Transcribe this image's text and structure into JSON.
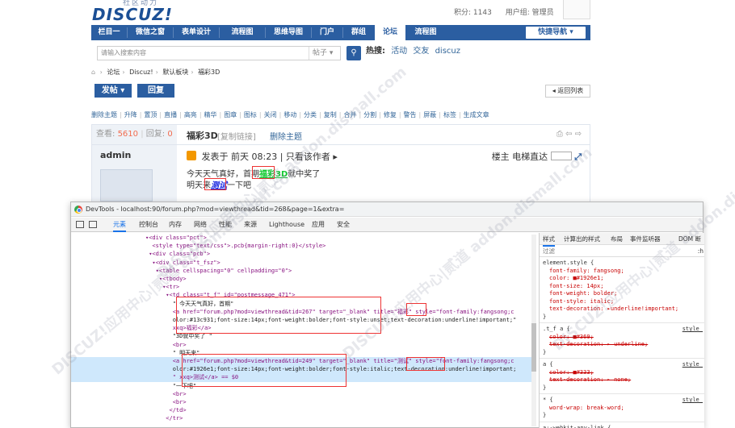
{
  "forum": {
    "logo_small": "社区动力",
    "logo_big": "DISCUZ!",
    "userbar": [
      "积分: 1143",
      "用户组: 管理员"
    ],
    "nav": [
      "栏目一",
      "微信之窗",
      "表单设计",
      "流程图",
      "思维导图",
      "门户",
      "群组",
      "论坛",
      "流程图"
    ],
    "nav_active": "论坛",
    "quick_nav": "快捷导航 ▾",
    "search_placeholder": "请输入搜索内容",
    "search_type": "帖子 ▾",
    "hot_label": "热搜:",
    "hot_links": [
      "活动",
      "交友",
      "discuz"
    ],
    "breadcrumb": [
      "论坛",
      "Discuz!",
      "默认板块",
      "福彩3D"
    ],
    "post_btn": "发帖 ▾",
    "reply_btn": "回复",
    "back_btn": "◂ 返回列表",
    "mod_actions": [
      "删除主题",
      "升降",
      "置顶",
      "直播",
      "高亮",
      "精华",
      "图章",
      "图标",
      "关闭",
      "移动",
      "分类",
      "复制",
      "合并",
      "分割",
      "修复",
      "警告",
      "屏蔽",
      "标签",
      "生成文章"
    ],
    "views_label": "查看:",
    "views": "5610",
    "replies_label": "回复:",
    "replies": "0",
    "thread_title": "福彩3D",
    "copy_link": "[复制链接]",
    "delete_thread": "删除主题",
    "author": "admin",
    "post_meta": "发表于 前天 08:23 | 只看该作者 ▸",
    "floor": "楼主  电梯直达",
    "body_line1_pre": "今天天气真好，首期",
    "body_link1": "福彩3D",
    "body_line1_post": "就中奖了",
    "body_line2_pre": "明天来",
    "body_link2": "测试",
    "body_line2_post": "一下吧"
  },
  "devtools": {
    "title": "DevTools - localhost:90/forum.php?mod=viewthread&tid=268&page=1&extra=",
    "tabs": [
      "元素",
      "控制台",
      "内存",
      "网络",
      "性能",
      "来源",
      "Lighthouse",
      "应用",
      "安全"
    ],
    "active_tab": "元素",
    "code_lines": [
      "▾<div class=\"pct\">",
      "  <style type=\"text/css\">.pcb{margin-right:0}</style>",
      " ▾<div class=\"pcb\">",
      "  ▾<div class=\"t_fsz\">",
      "   ▾<table cellspacing=\"0\" cellpadding=\"0\">",
      "    ▾<tbody>",
      "     ▾<tr>",
      "      ▾<td class=\"t_f\" id=\"postmessage_471\">",
      "        \" 今天天气真好，首期\"",
      "        <a href=\"forum.php?mod=viewthread&tid=267\" target=\"_blank\" title=\"福彩\" style=\"font-family:fangsong;c",
      "        olor:#13c931;font-size:14px;font-weight:bolder;font-style:unset;text-decoration:underline!important;\"",
      "        xxq>福彩</a>",
      "        \"3D就中奖了 \"",
      "        <br>",
      "        \" 明天来\"",
      "        <a href=\"forum.php?mod=viewthread&tid=249\" target=\"_blank\" title=\"测试\" style=\"font-family:fangsong;c",
      "        olor:#1926e1;font-size:14px;font-weight:bolder;font-style:italic;text-decoration:underline!important;",
      "        \" xxq>测试</a> == $0",
      "        \"一下吧\"",
      "        <br>",
      "        <br>",
      "       </td>",
      "      </tr>"
    ],
    "styles_tabs": [
      "样式",
      "计算出的样式",
      "布局",
      "事件监听器",
      "DOM 断"
    ],
    "filter_placeholder": "过滤",
    "filter_hov": ":h",
    "rules": [
      {
        "selector": "element.style {",
        "source": "",
        "props": [
          "font-family: fangsong;",
          "color: ■#1926e1;",
          "font-size: 14px;",
          "font-weight: bolder;",
          "font-style: italic;",
          "text-decoration: ▸underline!important;"
        ],
        "struck": false
      },
      {
        "selector": ".t_f a {",
        "source": "style_",
        "props": [
          "color: ■#369;",
          "text-decoration: ▸ underline;"
        ],
        "struck": true
      },
      {
        "selector": "a {",
        "source": "style_",
        "props": [
          "color: ■#333;",
          "text-decoration: ▸ none;"
        ],
        "struck": true
      },
      {
        "selector": "* {",
        "source": "style_",
        "props": [
          "word-wrap: break-word;"
        ],
        "struck": false
      },
      {
        "selector": "a:-webkit-any-link {",
        "source": "",
        "props": [],
        "struck": false
      }
    ],
    "colors": {
      "green_link": "#13c931",
      "blue_link": "#1926e1",
      "brand": "#2b5ea1"
    }
  },
  "watermark": "DISCUZ!应用中心|贰道 addon.dismall.com"
}
